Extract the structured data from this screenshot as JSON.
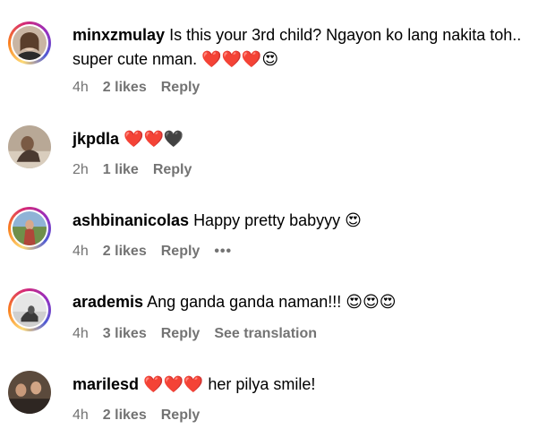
{
  "comments": [
    {
      "username": "minxzmulay",
      "text": "Is this your 3rd child? Ngayon ko lang nakita toh.. super cute nman.",
      "emoji": "❤️❤️❤️😍",
      "time": "4h",
      "likes": "2 likes",
      "reply": "Reply"
    },
    {
      "username": "jkpdla",
      "text": "",
      "emoji": "❤️❤️🖤",
      "time": "2h",
      "likes": "1 like",
      "reply": "Reply"
    },
    {
      "username": "ashbinanicolas",
      "text": "Happy pretty babyyy",
      "emoji": "😍",
      "time": "4h",
      "likes": "2 likes",
      "reply": "Reply",
      "more": "•••"
    },
    {
      "username": "arademis",
      "text": "Ang ganda ganda naman!!!",
      "emoji": "😍😍😍",
      "time": "4h",
      "likes": "3 likes",
      "reply": "Reply",
      "translation": "See translation"
    },
    {
      "username": "marilesd",
      "text": "her pilya smile!",
      "emoji": "❤️❤️❤️",
      "time": "4h",
      "likes": "2 likes",
      "reply": "Reply"
    }
  ],
  "colors": {
    "meta_text": "#737373",
    "story_ring": [
      "#feda75",
      "#fa7e1e",
      "#d62976",
      "#962fbf",
      "#4f5bd5"
    ]
  }
}
